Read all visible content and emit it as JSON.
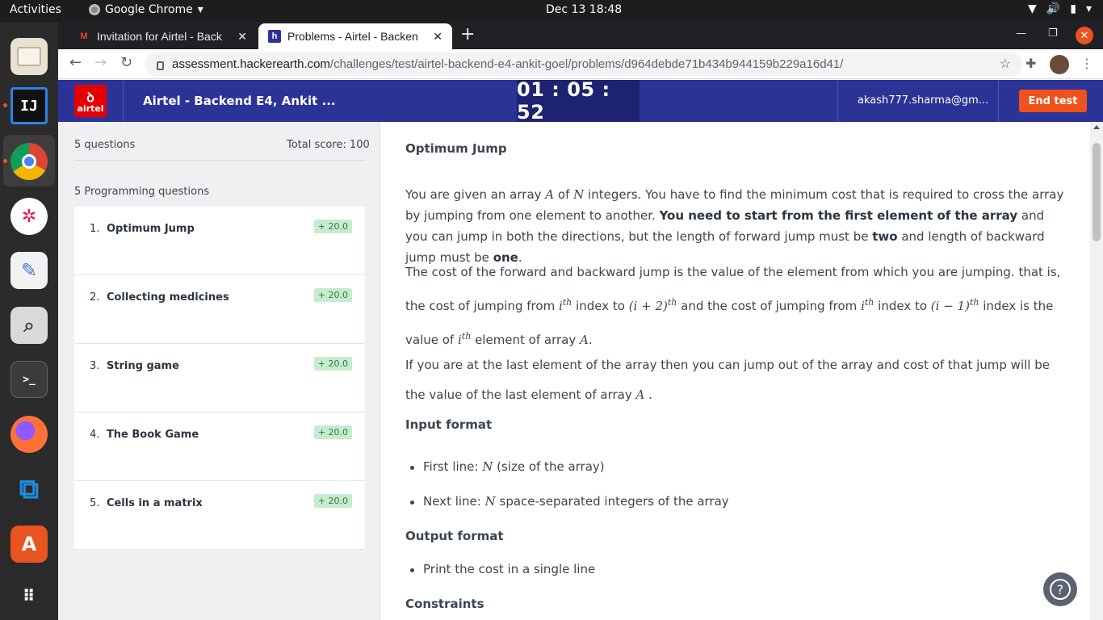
{
  "system": {
    "activities": "Activities",
    "app_name": "Google Chrome",
    "clock": "Dec 13  18:48"
  },
  "browser": {
    "tabs": [
      {
        "title": "Invitation for Airtel - Back",
        "favicon": "M"
      },
      {
        "title": "Problems - Airtel - Backen",
        "favicon": "h"
      }
    ],
    "url_host": "assessment.hackerearth.com",
    "url_path": "/challenges/test/airtel-backend-e4-ankit-goel/problems/d964debde71b434b944159b229a16d41/"
  },
  "header": {
    "logo_text": "airtel",
    "test_title": "Airtel - Backend E4, Ankit ...",
    "timer": "01 : 05 : 52",
    "user_email": "akash777.sharma@gm...",
    "end_button": "End test"
  },
  "sidebar": {
    "question_count": "5 questions",
    "total_score": "Total score: 100",
    "section_heading": "5 Programming questions",
    "questions": [
      {
        "num": "1.",
        "name": "Optimum Jump",
        "score": "+ 20.0"
      },
      {
        "num": "2.",
        "name": "Collecting medicines",
        "score": "+ 20.0"
      },
      {
        "num": "3.",
        "name": "String game",
        "score": "+ 20.0"
      },
      {
        "num": "4.",
        "name": "The Book Game",
        "score": "+ 20.0"
      },
      {
        "num": "5.",
        "name": "Cells in a matrix",
        "score": "+ 20.0"
      }
    ]
  },
  "problem": {
    "title": "Optimum Jump",
    "p1_a": "You are given an array ",
    "p1_b": " of ",
    "p1_c": "  integers. You have to find the minimum cost that is required to cross the array by jumping from one element to another. ",
    "p1_bold": "You need to start from the first element of the array",
    "p1_d": " and you can jump in both the directions, but the length of forward jump must be ",
    "p1_two": "two",
    "p1_e": " and length of backward jump must be ",
    "p1_one": "one",
    "p1_f": ".",
    "p2_a": "The cost of the forward and backward jump is the value of the element from which you are jumping. that is, the cost of jumping from ",
    "p2_b": " index to ",
    "p2_c": " and the cost of jumping from ",
    "p2_d": " index to ",
    "p2_e": " index is the value of ",
    "p2_f": " element of array ",
    "p2_g": ".",
    "p3_a": "If you are at the last element of the array then you can jump out of the array and cost of that jump will be the value of the last element of array ",
    "p3_b": " .",
    "math_A": "A",
    "math_N": "N",
    "math_i": "i",
    "math_th": "th",
    "math_i_plus_2": "(i + 2)",
    "math_i_minus_1": "(i − 1)",
    "input_format": "Input format",
    "input_1_a": "First line: ",
    "input_1_b": " (size of the array)",
    "input_2_a": "Next line: ",
    "input_2_b": " space-separated integers of the array",
    "output_format": "Output format",
    "output_1": "Print the cost in a single line",
    "constraints": "Constraints"
  },
  "help_label": "?"
}
